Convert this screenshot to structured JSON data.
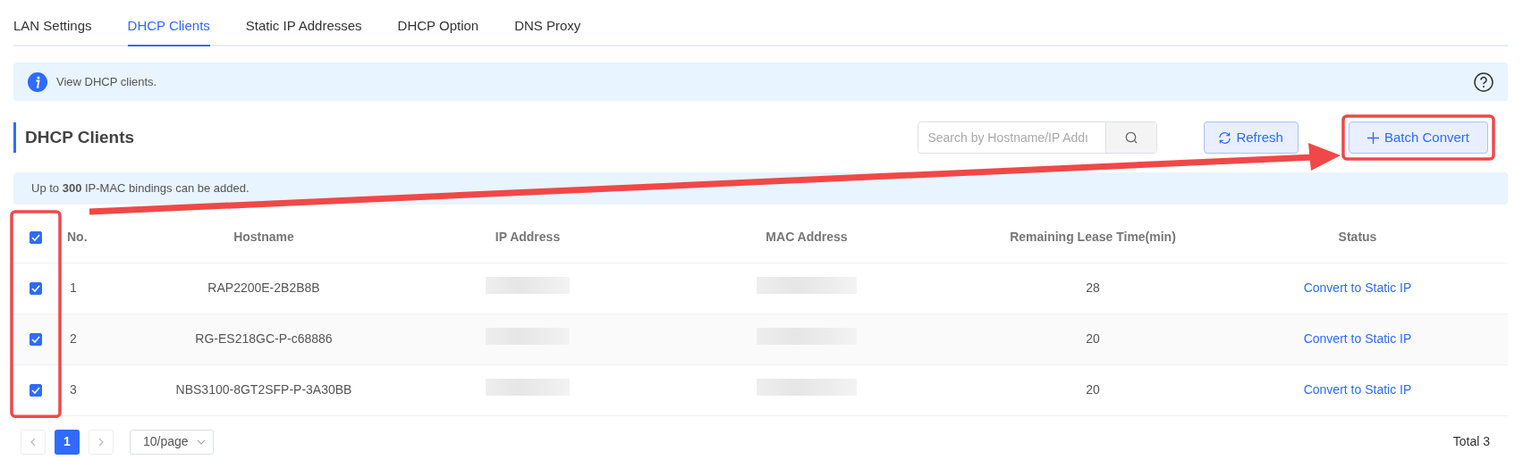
{
  "tabs": [
    {
      "label": "LAN Settings",
      "selected": false
    },
    {
      "label": "DHCP Clients",
      "selected": true
    },
    {
      "label": "Static IP Addresses",
      "selected": false
    },
    {
      "label": "DHCP Option",
      "selected": false
    },
    {
      "label": "DNS Proxy",
      "selected": false
    }
  ],
  "info": {
    "text": "View DHCP clients."
  },
  "section": {
    "title": "DHCP Clients"
  },
  "search": {
    "placeholder": "Search by Hostname/IP Addı"
  },
  "buttons": [
    {
      "kind": "refresh",
      "label": "Refresh"
    },
    {
      "kind": "add",
      "label": "Batch Convert"
    }
  ],
  "notice": {
    "text": "Up to **300** IP-MAC bindings can be added."
  },
  "table": {
    "all_checked": true,
    "columns": [
      "No.",
      "Hostname",
      "IP Address",
      "MAC Address",
      "Remaining Lease Time(min)",
      "Status"
    ],
    "rows": [
      {
        "checked": true,
        "no": "1",
        "hostname": "RAP2200E-2B2B8B",
        "lease": "28",
        "action": "Convert to Static IP"
      },
      {
        "checked": true,
        "no": "2",
        "hostname": "RG-ES218GC-P-c68886",
        "lease": "20",
        "action": "Convert to Static IP"
      },
      {
        "checked": true,
        "no": "3",
        "hostname": "NBS3100-8GT2SFP-P-3A30BB",
        "lease": "20",
        "action": "Convert to Static IP"
      }
    ]
  },
  "pagination": {
    "pages": [
      {
        "label": "1",
        "selected": true
      }
    ],
    "page_size": "10/page",
    "total": "Total 3"
  },
  "annotations": [
    {
      "kind": "checkbox-frame"
    },
    {
      "kind": "button-frame"
    },
    {
      "kind": "arrow"
    }
  ]
}
